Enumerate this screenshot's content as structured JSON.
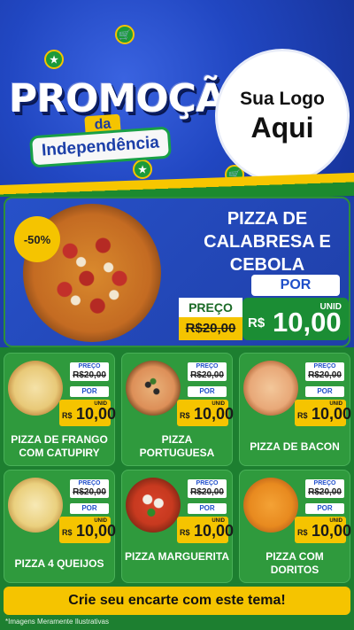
{
  "header": {
    "title": "PROMOÇÃO",
    "connector": "da",
    "subtitle": "Independência",
    "logo_line1": "Sua Logo",
    "logo_line2": "Aqui"
  },
  "featured": {
    "discount": "-50%",
    "name": "PIZZA DE CALABRESA E CEBOLA",
    "por_label": "POR",
    "preco_label": "PREÇO",
    "old_price": "R$20,00",
    "unit_label": "UNID",
    "currency": "R$",
    "new_price": "10,00"
  },
  "cards": [
    {
      "name": "PIZZA DE FRANGO COM CATUPIRY",
      "preco_label": "PREÇO",
      "old_price": "R$20,00",
      "por_label": "POR",
      "unit_label": "UNID",
      "currency": "R$",
      "new_price": "10,00"
    },
    {
      "name": "PIZZA PORTUGUESA",
      "preco_label": "PREÇO",
      "old_price": "R$20,00",
      "por_label": "POR",
      "unit_label": "UNID",
      "currency": "R$",
      "new_price": "10,00"
    },
    {
      "name": "PIZZA DE BACON",
      "preco_label": "PREÇO",
      "old_price": "R$20,00",
      "por_label": "POR",
      "unit_label": "UNID",
      "currency": "R$",
      "new_price": "10,00"
    },
    {
      "name": "PIZZA 4 QUEIJOS",
      "preco_label": "PREÇO",
      "old_price": "R$20,00",
      "por_label": "POR",
      "unit_label": "UNID",
      "currency": "R$",
      "new_price": "10,00"
    },
    {
      "name": "PIZZA MARGUERITA",
      "preco_label": "PREÇO",
      "old_price": "R$20,00",
      "por_label": "POR",
      "unit_label": "UNID",
      "currency": "R$",
      "new_price": "10,00"
    },
    {
      "name": "PIZZA COM DORITOS",
      "preco_label": "PREÇO",
      "old_price": "R$20,00",
      "por_label": "POR",
      "unit_label": "UNID",
      "currency": "R$",
      "new_price": "10,00"
    }
  ],
  "cta": "Crie seu encarte com este tema!",
  "disclaimer": "*Imagens Meramente Ilustrativas",
  "colors": {
    "brand_blue": "#1e3fa8",
    "brand_green": "#1d7f30",
    "brand_yellow": "#f5c400"
  }
}
